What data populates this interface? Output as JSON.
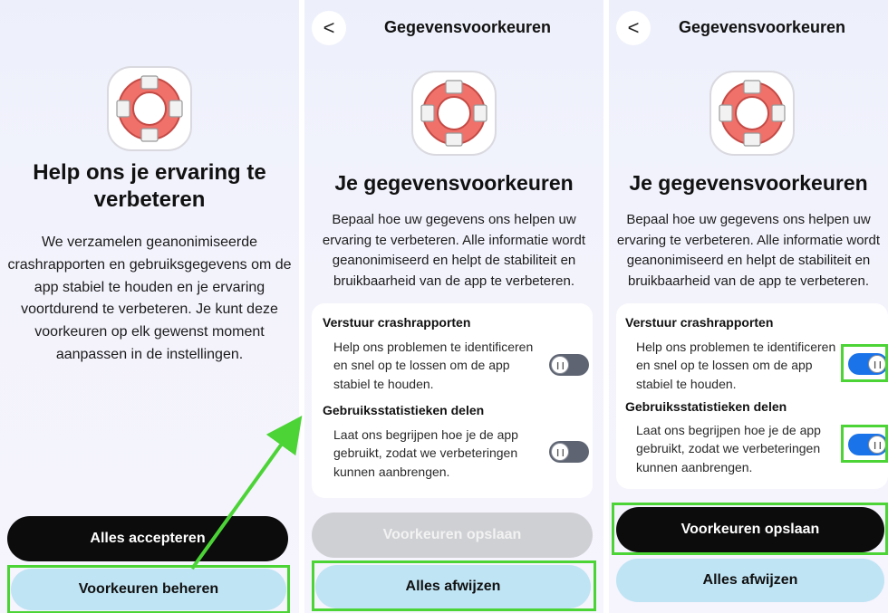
{
  "screen1": {
    "title": "Help ons je ervaring te verbeteren",
    "description": "We verzamelen geanonimiseerde crashrapporten en gebruiksgegevens om de app stabiel te houden en je ervaring voortdurend te verbeteren. Je kunt deze voorkeuren op elk gewenst moment aanpassen in de instellingen.",
    "accept_all_label": "Alles accepteren",
    "manage_prefs_label": "Voorkeuren beheren"
  },
  "screen2": {
    "back_icon": "<",
    "header_title": "Gegevensvoorkeuren",
    "title": "Je gegevensvoorkeuren",
    "description": "Bepaal hoe uw gegevens ons helpen uw ervaring te verbeteren. Alle informatie wordt geanonimiseerd en helpt de stabiliteit en bruikbaarheid van de app te verbeteren.",
    "crash_title": "Verstuur crashrapporten",
    "crash_desc": "Help ons problemen te identificeren en snel op te lossen om de app stabiel te houden.",
    "crash_toggle_state": "off",
    "stats_title": "Gebruiksstatistieken delen",
    "stats_desc": "Laat ons begrijpen hoe je de app gebruikt, zodat we verbeteringen kunnen aanbrengen.",
    "stats_toggle_state": "off",
    "save_label": "Voorkeuren opslaan",
    "save_state": "disabled",
    "reject_all_label": "Alles afwijzen"
  },
  "screen3": {
    "back_icon": "<",
    "header_title": "Gegevensvoorkeuren",
    "title": "Je gegevensvoorkeuren",
    "description": "Bepaal hoe uw gegevens ons helpen uw ervaring te verbeteren. Alle informatie wordt geanonimiseerd en helpt de stabiliteit en bruikbaarheid van de app te verbeteren.",
    "crash_title": "Verstuur crashrapporten",
    "crash_desc": "Help ons problemen te identificeren en snel op te lossen om de app stabiel te houden.",
    "crash_toggle_state": "on",
    "stats_title": "Gebruiksstatistieken delen",
    "stats_desc": "Laat ons begrijpen hoe je de app gebruikt, zodat we verbeteringen kunnen aanbrengen.",
    "stats_toggle_state": "on",
    "save_label": "Voorkeuren opslaan",
    "save_state": "enabled",
    "reject_all_label": "Alles afwijzen"
  },
  "colors": {
    "highlight": "#4cd437",
    "toggle_on": "#1a73e8",
    "toggle_off": "#5e6472",
    "primary_button": "#0c0c0c",
    "secondary_button": "#bfe4f4",
    "disabled_button": "#cfd0d4",
    "buoy_red": "#f0706a",
    "buoy_white": "#f2f2f2"
  },
  "icons": {
    "back": "chevron-left-icon",
    "logo": "lifebuoy-icon",
    "toggle_knob": "pause-bars-icon"
  }
}
